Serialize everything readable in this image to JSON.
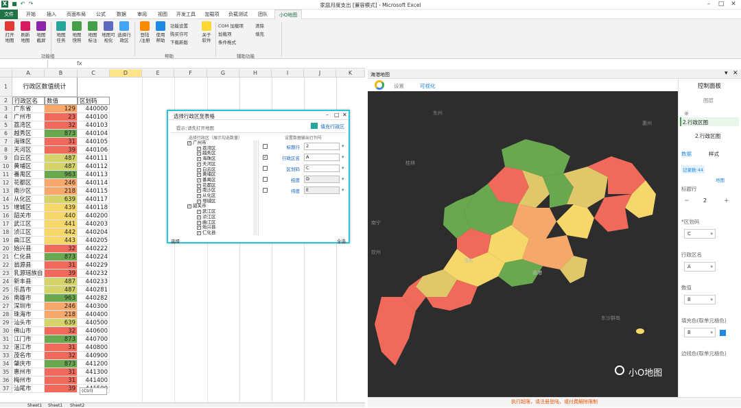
{
  "app": {
    "title": "家庭月度支出 [兼容模式] - Microsoft Excel"
  },
  "tabs": [
    "文件",
    "开始",
    "插入",
    "页面布局",
    "公式",
    "数据",
    "审阅",
    "视图",
    "开发工具",
    "加载项",
    "负载测试",
    "团队",
    "小O地图"
  ],
  "ribbon": {
    "buttons": [
      {
        "label": "打开\n地图",
        "color": "#e53935"
      },
      {
        "label": "刷新\n地图",
        "color": "#d81b60"
      },
      {
        "label": "地图\n截屏",
        "color": "#8e24aa"
      },
      {
        "label": "地图\n任务",
        "color": "#26a69a"
      },
      {
        "label": "地图\n快照",
        "color": "#43a047"
      },
      {
        "label": "地图\n标注",
        "color": "#43a047"
      },
      {
        "label": "地图可\n视化",
        "color": "#5c6bc0"
      },
      {
        "label": "选择行\n政区",
        "color": "#42a5f5"
      },
      {
        "label": "登陆\n/注册",
        "color": "#fb8c00"
      },
      {
        "label": "使用\n帮助",
        "color": "#1e88e5"
      },
      {
        "label": "关于\n软件",
        "color": "#fdd835"
      }
    ],
    "small": [
      "功能设置",
      "购买许可",
      "下载新版",
      "COM 加载项",
      "加载项",
      "条件格式",
      "清除",
      "填充"
    ],
    "groups": [
      "功能组",
      "帮助",
      "辅助功能"
    ]
  },
  "columns": [
    "A",
    "B",
    "C",
    "D",
    "E",
    "F",
    "G",
    "H",
    "I",
    "J",
    "K"
  ],
  "sheet": {
    "title": "行政区数值统计",
    "headers": [
      "行政区名",
      "数值",
      "区划码"
    ],
    "rows": [
      [
        "广东省",
        "129",
        "440000"
      ],
      [
        "广州市",
        "23",
        "440100"
      ],
      [
        "荔湾区",
        "32",
        "440103"
      ],
      [
        "越秀区",
        "873",
        "440104"
      ],
      [
        "海珠区",
        "31",
        "440105"
      ],
      [
        "天河区",
        "39",
        "440106"
      ],
      [
        "白云区",
        "487",
        "440111"
      ],
      [
        "黄埔区",
        "487",
        "440112"
      ],
      [
        "番禺区",
        "963",
        "440113"
      ],
      [
        "花都区",
        "246",
        "440114"
      ],
      [
        "南沙区",
        "218",
        "440115"
      ],
      [
        "从化区",
        "639",
        "440117"
      ],
      [
        "增城区",
        "439",
        "440118"
      ],
      [
        "韶关市",
        "440",
        "440200"
      ],
      [
        "武江区",
        "441",
        "440203"
      ],
      [
        "浈江区",
        "442",
        "440204"
      ],
      [
        "曲江区",
        "443",
        "440205"
      ],
      [
        "始兴县",
        "32",
        "440222"
      ],
      [
        "仁化县",
        "873",
        "440224"
      ],
      [
        "翁源县",
        "31",
        "440229"
      ],
      [
        "乳源瑶族自",
        "39",
        "440232"
      ],
      [
        "新丰县",
        "487",
        "440233"
      ],
      [
        "乐昌市",
        "487",
        "440281"
      ],
      [
        "南雄市",
        "963",
        "440282"
      ],
      [
        "深圳市",
        "246",
        "440300"
      ],
      [
        "珠海市",
        "218",
        "440400"
      ],
      [
        "汕头市",
        "639",
        "440500"
      ],
      [
        "佛山市",
        "32",
        "440600"
      ],
      [
        "江门市",
        "873",
        "440700"
      ],
      [
        "湛江市",
        "31",
        "440800"
      ],
      [
        "茂名市",
        "32",
        "440900"
      ],
      [
        "肇庆市",
        "873",
        "441200"
      ],
      [
        "惠州市",
        "31",
        "441300"
      ],
      [
        "梅州市",
        "31",
        "441400"
      ],
      [
        "汕尾市",
        "39",
        "441500"
      ]
    ],
    "tabs": [
      "Sheet1",
      "Sheet1",
      "Sheet2"
    ],
    "paste_hint": "(Ctrl)"
  },
  "dialog": {
    "title": "选择行政区至表格",
    "hint": "提示：",
    "hint_text": "请先打开地图",
    "fill_button": "填充行政区",
    "left_title": "选择行政区（展示勾选数量）",
    "right_title": "设置数据输出行列号",
    "tree": [
      "广州市",
      "荔湾区",
      "越秀区",
      "海珠区",
      "天河区",
      "白云区",
      "黄埔区",
      "番禺区",
      "花都区",
      "南沙区",
      "从化区",
      "增城区",
      "韶关市",
      "武江区",
      "浈江区",
      "曲江区",
      "始兴县",
      "仁化县"
    ],
    "rows": [
      {
        "label": "标题行",
        "value": "2",
        "checked": false
      },
      {
        "label": "行政区名",
        "value": "A",
        "checked": true
      },
      {
        "label": "区划码",
        "value": "C",
        "checked": false
      },
      {
        "label": "经度",
        "value": "D",
        "checked": false
      },
      {
        "label": "纬度",
        "value": "E",
        "checked": false
      }
    ],
    "footer_left": "选择",
    "footer_right": "全选"
  },
  "map": {
    "pane_title": "海港地图",
    "tabs": [
      "设置",
      "可视化"
    ],
    "places": [
      "东州",
      "惠州",
      "桂林",
      "南宁",
      "钦州",
      "茂名",
      "香港",
      "东沙群岛",
      "小O地图"
    ]
  },
  "panel": {
    "title": "控制面板",
    "section": "图层",
    "layer": "2.行政区图",
    "layer_title": "2.行政区图",
    "tabs": [
      "数据",
      "样式"
    ],
    "record": "记录数:44",
    "link": "地图",
    "fields": [
      {
        "label": "标题行",
        "value": "2"
      },
      {
        "label": "*区划码",
        "value": "C"
      },
      {
        "label": "行政区名",
        "value": "A"
      },
      {
        "label": "数值",
        "value": "B"
      },
      {
        "label": "填充色(取单元格色)",
        "value": "B"
      },
      {
        "label": "边线色(取单元格色)",
        "value": ""
      }
    ]
  },
  "status": {
    "text": "执行超限，请注册登陆，或付费解除限制"
  }
}
